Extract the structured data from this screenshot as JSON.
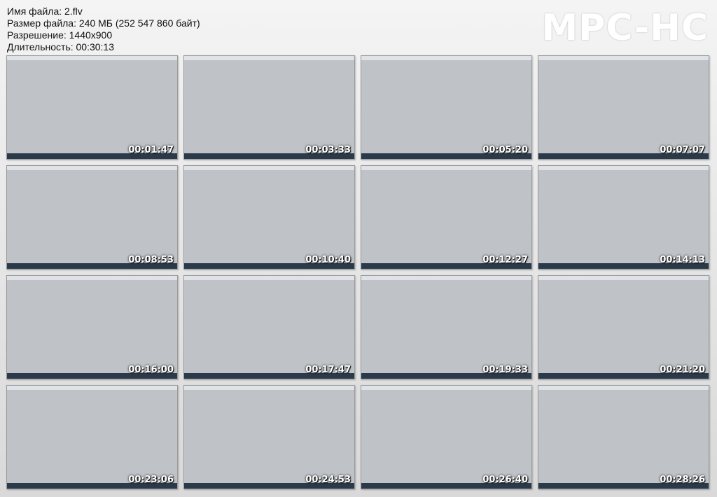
{
  "info": {
    "filename": "Имя файла: 2.flv",
    "filesize": "Размер файла: 240 МБ (252 547 860 байт)",
    "resolution": "Разрешение: 1440x900",
    "duration": "Длительность: 00:30:13"
  },
  "logo": "MPC-HC",
  "thumbnails": [
    "00:01:47",
    "00:03:33",
    "00:05:20",
    "00:07:07",
    "00:08:53",
    "00:10:40",
    "00:12:27",
    "00:14:13",
    "00:16:00",
    "00:17:47",
    "00:19:33",
    "00:21:20",
    "00:23:06",
    "00:24:53",
    "00:26:40",
    "00:28:26"
  ]
}
